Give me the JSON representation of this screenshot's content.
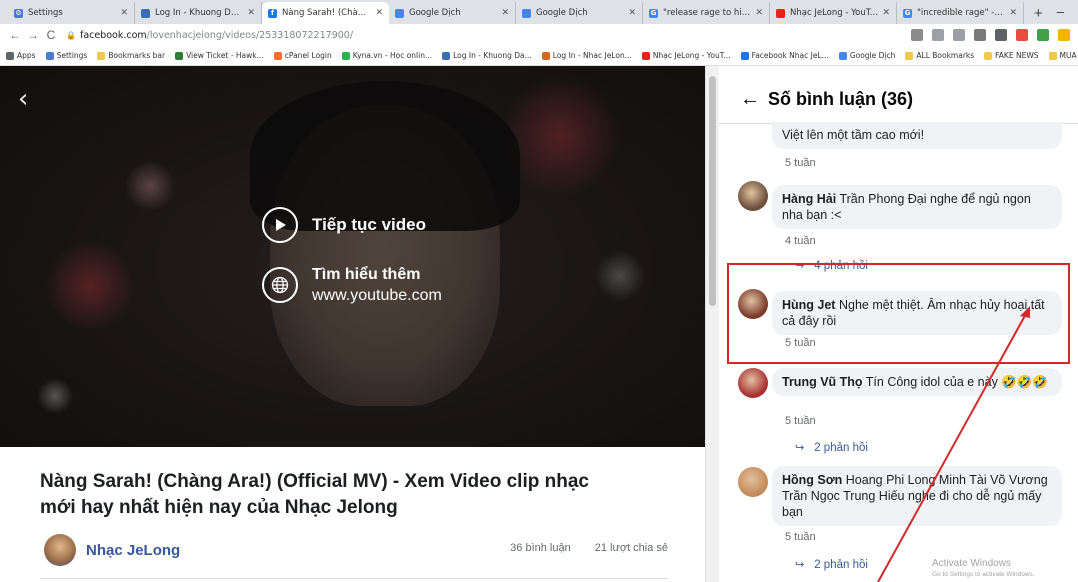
{
  "browser": {
    "tabs": [
      {
        "title": "Settings",
        "color": "#4a7bd0",
        "glyph": "⚙",
        "active": false
      },
      {
        "title": "Log In - Khuong Dat Long",
        "color": "#3c6fb0",
        "glyph": "",
        "active": false
      },
      {
        "title": "Nàng Sarah! (Chàng Ara!) (",
        "color": "#1877f2",
        "glyph": "f",
        "active": true
      },
      {
        "title": "Google Dịch",
        "color": "#4285f4",
        "glyph": "",
        "active": false
      },
      {
        "title": "Google Dịch",
        "color": "#4285f4",
        "glyph": "",
        "active": false
      },
      {
        "title": "\"release rage to him\" - Goo",
        "color": "#4285f4",
        "glyph": "G",
        "active": false
      },
      {
        "title": "Nhạc JeLong - YouTube",
        "color": "#e62117",
        "glyph": "",
        "active": false
      },
      {
        "title": "\"incredible rage\" - Google",
        "color": "#4285f4",
        "glyph": "G",
        "active": false
      }
    ],
    "new_tab": "+",
    "minimize": "–",
    "url_host": "facebook.com",
    "url_path": "/lovenhacjelong/videos/253318072217900/",
    "bookmarks": [
      {
        "label": "Apps",
        "color": "#5f6368"
      },
      {
        "label": "Settings",
        "color": "#4a7bd0"
      },
      {
        "label": "Bookmarks bar",
        "color": "#f2c94c"
      },
      {
        "label": "View Ticket - Hawk...",
        "color": "#2e7d32"
      },
      {
        "label": "cPanel Login",
        "color": "#ff6c2c"
      },
      {
        "label": "Kyna.vn - Học onlin...",
        "color": "#2bb24c"
      },
      {
        "label": "Log In - Khuong Da...",
        "color": "#3c6fb0"
      },
      {
        "label": "Log In - Nhac JeLon...",
        "color": "#d2691e"
      },
      {
        "label": "Nhạc JeLong - YouT...",
        "color": "#e62117"
      },
      {
        "label": "Facebook Nhạc JeL...",
        "color": "#1877f2"
      },
      {
        "label": "Google Dịch",
        "color": "#4285f4"
      },
      {
        "label": "ALL Bookmarks",
        "color": "#f2c94c"
      },
      {
        "label": "FAKE NEWS",
        "color": "#f2c94c"
      },
      {
        "label": "MUA CHUNG CU V...",
        "color": "#f2c94c"
      }
    ]
  },
  "video": {
    "continue_label": "Tiếp tục video",
    "learn_more_label": "Tìm hiểu thêm",
    "learn_more_url": "www.youtube.com",
    "title": "Nàng Sarah! (Chàng Ara!) (Official MV) - Xem Video clip nhạc mới hay nhất hiện nay của Nhạc Jelong",
    "channel_name": "Nhạc JeLong",
    "comments_count": "36 bình luận",
    "shares_count": "21 lượt chia sẻ"
  },
  "comments_panel": {
    "title": "Số bình luận (36)",
    "partial_top": {
      "text": "Việt lên một tầm cao mới!",
      "time": "5 tuần"
    },
    "comments": [
      {
        "author": "Hàng Hải",
        "text": "Trần Phong Đại nghe để ngủ ngon nha bạn :<",
        "time": "4 tuần",
        "replies": "4 phản hồi",
        "avatar": "#6b4f3a"
      },
      {
        "author": "Hùng Jet",
        "text": "Nghe mệt thiệt. Âm nhạc hủy hoại tất cả đây rồi",
        "time": "5 tuần",
        "replies": "",
        "avatar": "#7a3a2a"
      },
      {
        "author": "Trung Vũ Thọ",
        "text": "Tín Công idol của e này 🤣🤣🤣",
        "time": "5 tuần",
        "replies": "2 phản hồi",
        "avatar": "#a83232"
      },
      {
        "author": "Hồng Sơn",
        "text": "Hoang Phi Long Minh Tài Võ Vương Trần Ngọc Trung Hiếu nghe đi cho dễ ngủ mấy bạn",
        "time": "5 tuần",
        "replies": "2 phản hồi",
        "avatar": "#c48a5a"
      }
    ]
  },
  "windows_watermark": {
    "line1": "Activate Windows",
    "line2": "Go to Settings to activate Windows."
  },
  "annotation_color": "#d22a2a"
}
